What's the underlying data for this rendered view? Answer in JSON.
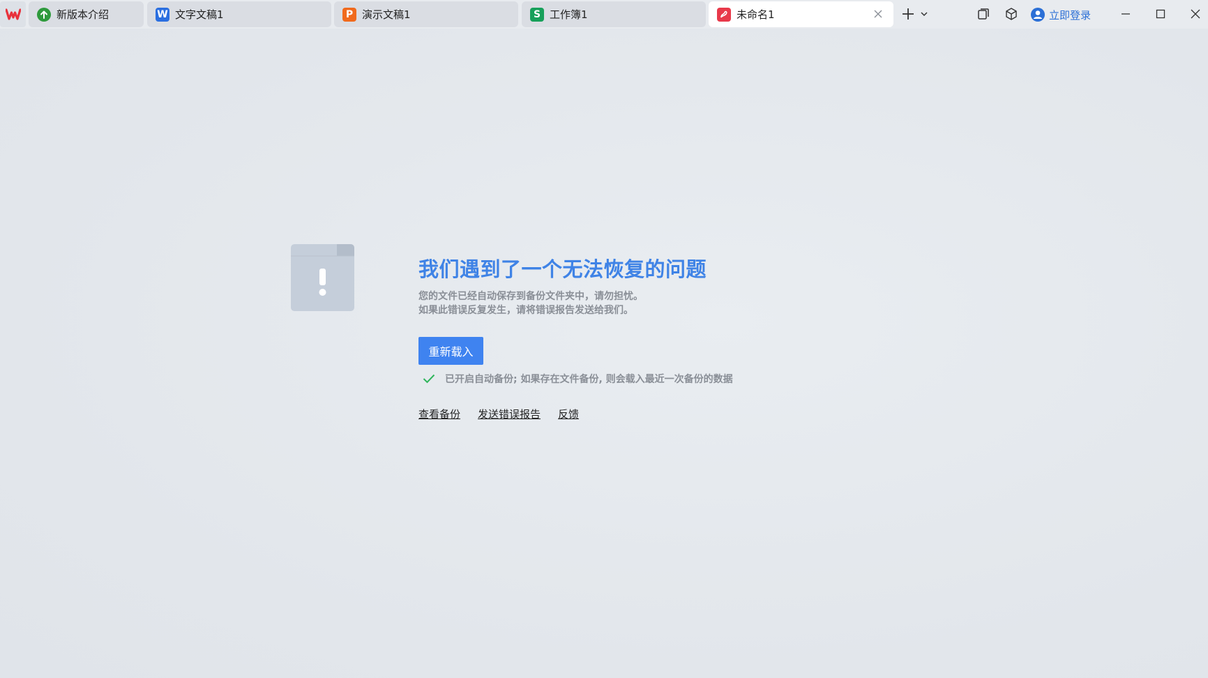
{
  "tabs": [
    {
      "label": "新版本介绍",
      "icon": "upgrade-arrow-icon",
      "color": "#2e9a3c",
      "glyph": "↑"
    },
    {
      "label": "文字文稿1",
      "icon": "wps-writer-icon",
      "color": "#2b6fe0",
      "glyph": "W"
    },
    {
      "label": "演示文稿1",
      "icon": "wps-presentation-icon",
      "color": "#f06a1d",
      "glyph": "P"
    },
    {
      "label": "工作簿1",
      "icon": "wps-spreadsheet-icon",
      "color": "#17a05a",
      "glyph": "S"
    },
    {
      "label": "未命名1",
      "icon": "wps-pdf-icon",
      "color": "#e8394a",
      "glyph": "⸙",
      "active": true
    }
  ],
  "header": {
    "login_label": "立即登录"
  },
  "error": {
    "title": "我们遇到了一个无法恢复的问题",
    "desc_line1": "您的文件已经自动保存到备份文件夹中，请勿担忧。",
    "desc_line2": "如果此错误反复发生，请将错误报告发送给我们。",
    "reload_label": "重新载入",
    "backup_note": "已开启自动备份; 如果存在文件备份, 则会载入最近一次备份的数据",
    "links": {
      "view_backup": "查看备份",
      "send_report": "发送错误报告",
      "feedback": "反馈"
    }
  },
  "colors": {
    "accent": "#3f83e6",
    "check": "#2fb55b",
    "brand_red": "#e8323c"
  }
}
